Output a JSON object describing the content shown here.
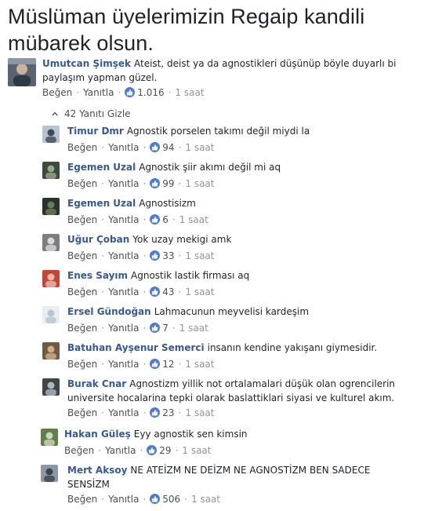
{
  "post": {
    "title": "Müslüman üyelerimizin Regaip kandili mübarek olsun."
  },
  "actions": {
    "like": "Beğen",
    "reply": "Yanıtla",
    "sep": "·"
  },
  "top_comment": {
    "author": "Umutcan Şimşek",
    "text": "Ateist, deist ya da agnostikleri düşünüp böyle duyarlı bi paylaşım yapman güzel.",
    "likes": "1.016",
    "time": "1 saat"
  },
  "replies_toggle": {
    "label": "42 Yanıtı Gizle",
    "chevron": "chevron-up-icon"
  },
  "replies": [
    {
      "author": "Timur Dmr",
      "text": "Agnostik porselen takımı değil miydi la",
      "likes": "94",
      "time": "1 saat"
    },
    {
      "author": "Egemen Uzal",
      "text": "Agnostik şiir akımı değil mi aq",
      "likes": "99",
      "time": "1 saat"
    },
    {
      "author": "Egemen Uzal",
      "text": "Agnostisizm",
      "likes": "6",
      "time": "1 saat"
    },
    {
      "author": "Uğur Çoban",
      "text": "Yok uzay mekigi amk",
      "likes": "33",
      "time": "1 saat"
    },
    {
      "author": "Enes Sayım",
      "text": "Agnostik lastik firması aq",
      "likes": "43",
      "time": "1 saat"
    },
    {
      "author": "Ersel Gündoğan",
      "text": "Lahmacunun meyvelisi kardeşim",
      "likes": "7",
      "time": "1 saat"
    },
    {
      "author": "Batuhan Ayşenur Semerci",
      "text": "insanın kendine yakışanı giymesidir.",
      "likes": "12",
      "time": "1 saat"
    },
    {
      "author": "Burak Cnar",
      "text": "Agnostizm yillik not ortalamalari düşük olan ogrencilerin universite hocalarina tepki olarak baslattiklari siyasi ve kulturel akım.",
      "likes": "23",
      "time": "1 saat"
    },
    {
      "author": "Hakan Güleş",
      "text": "Eyy agnostik sen kimsin",
      "likes": "29",
      "time": "1 saat"
    },
    {
      "author": "Mert Aksoy",
      "text": "NE ATEİZM NE DEİZM NE AGNOSTİZM BEN SADECE SENSİZM",
      "likes": "506",
      "time": "1 saat"
    }
  ],
  "colors": {
    "author_link": "#365899",
    "text": "#1d2129",
    "meta": "#90949c",
    "like_badge": "#4b7bd6"
  }
}
